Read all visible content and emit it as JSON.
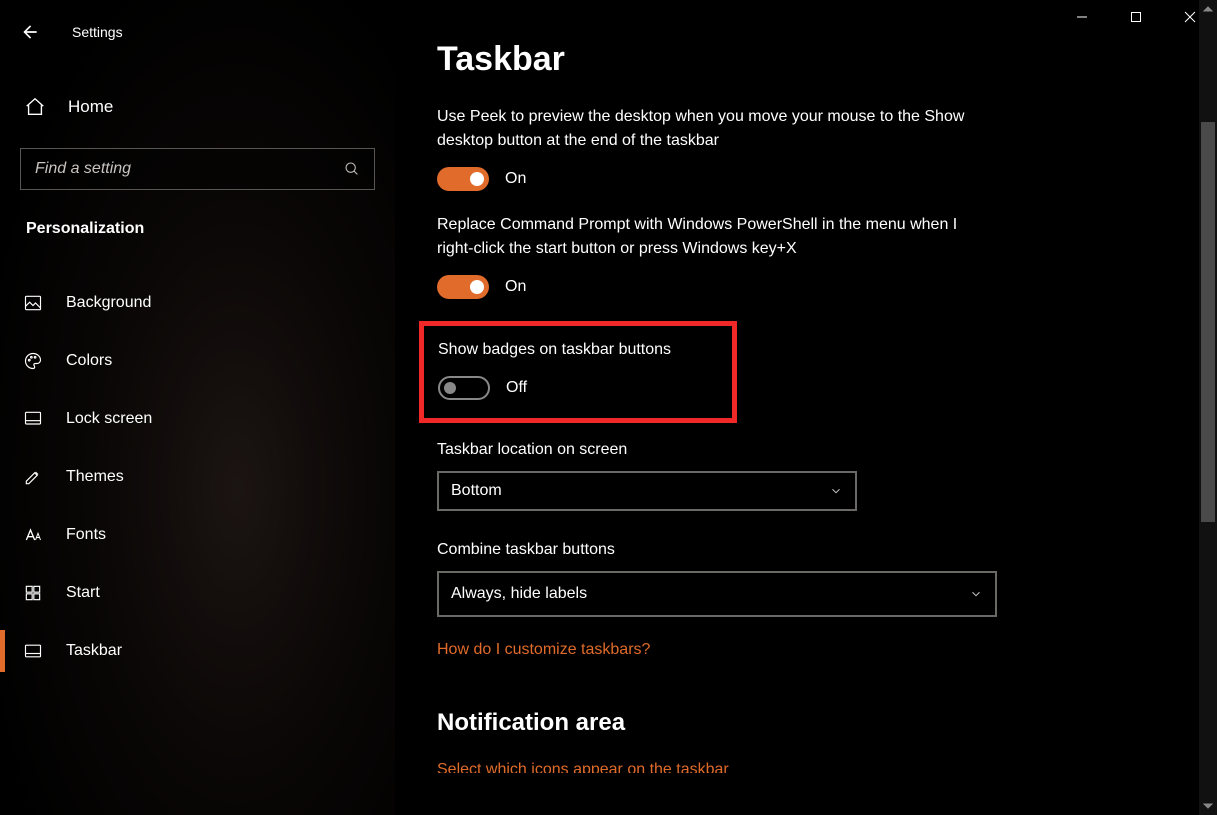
{
  "window": {
    "title": "Settings"
  },
  "sidebar": {
    "home_label": "Home",
    "search_placeholder": "Find a setting",
    "category": "Personalization",
    "items": [
      {
        "label": "Background"
      },
      {
        "label": "Colors"
      },
      {
        "label": "Lock screen"
      },
      {
        "label": "Themes"
      },
      {
        "label": "Fonts"
      },
      {
        "label": "Start"
      },
      {
        "label": "Taskbar"
      }
    ]
  },
  "main": {
    "title": "Taskbar",
    "peek_desc": "Use Peek to preview the desktop when you move your mouse to the Show desktop button at the end of the taskbar",
    "peek_state": "On",
    "powershell_desc": "Replace Command Prompt with Windows PowerShell in the menu when I right-click the start button or press Windows key+X",
    "powershell_state": "On",
    "badges_desc": "Show badges on taskbar buttons",
    "badges_state": "Off",
    "location_label": "Taskbar location on screen",
    "location_value": "Bottom",
    "combine_label": "Combine taskbar buttons",
    "combine_value": "Always, hide labels",
    "customize_link": "How do I customize taskbars?",
    "notification_title": "Notification area",
    "select_icons_link": "Select which icons appear on the taskbar"
  },
  "colors": {
    "accent": "#e06b2a",
    "highlight": "#f02828"
  }
}
